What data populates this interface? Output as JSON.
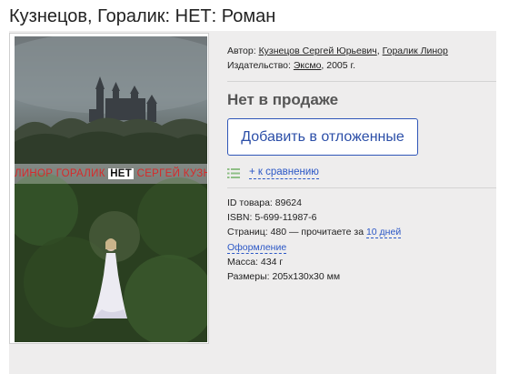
{
  "page": {
    "title": "Кузнецов, Горалик: НЕТ: Роман"
  },
  "cover": {
    "author_left": "ЛИНОР ГОРАЛИК",
    "title": "НЕТ",
    "author_right": "СЕРГЕЙ КУЗНЕЦОВ"
  },
  "meta": {
    "author_label": "Автор:",
    "authors": [
      "Кузнецов Сергей Юрьевич",
      "Горалик Линор"
    ],
    "author_separator": ",",
    "publisher_label": "Издательство:",
    "publisher": "Эксмо",
    "year": ", 2005 г."
  },
  "availability": "Нет в продаже",
  "wishlist_button": "Добавить в отложенные",
  "compare": {
    "icon": "list-icon",
    "label": "+ к сравнению"
  },
  "details": {
    "id_label": "ID товара:",
    "id_value": "89624",
    "isbn_label": "ISBN:",
    "isbn_value": "5-699-11987-6",
    "pages_text": "Страниц: 480 — прочитаете за",
    "read_time": "10 дней",
    "design_link": "Оформление",
    "mass_label": "Масса:",
    "mass_value": "434 г",
    "size_label": "Размеры:",
    "size_value": "205x130x30 мм"
  },
  "colors": {
    "link_blue": "#2c58c6",
    "button_border": "#2f56b8",
    "panel_bg": "#eeeded",
    "cover_red": "#d62a2a"
  }
}
